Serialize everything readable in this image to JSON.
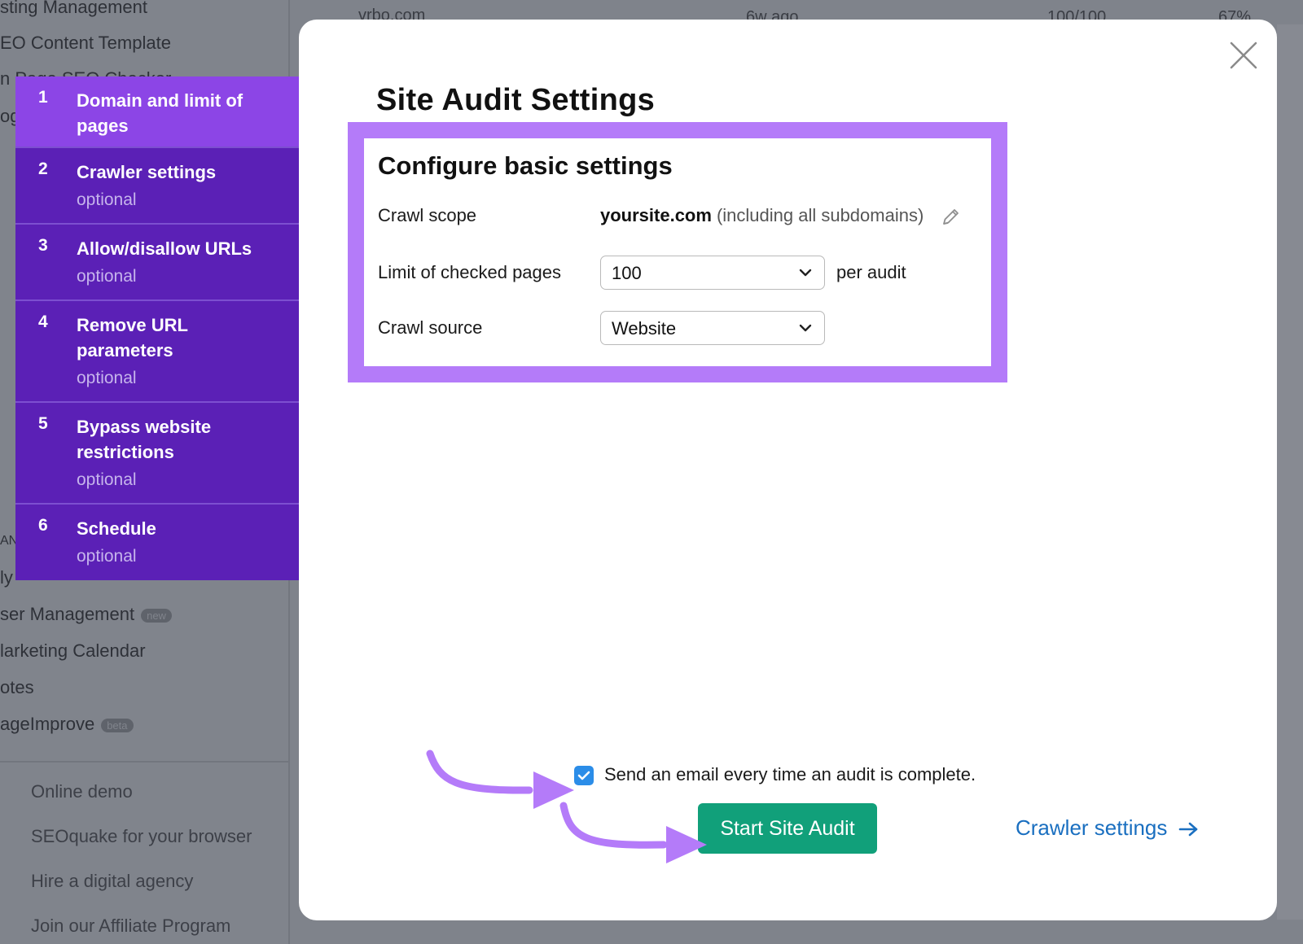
{
  "background": {
    "sidebar_items": [
      {
        "label": "sting Management"
      },
      {
        "label": "EO Content Template"
      },
      {
        "label": "n Page SEO Checker"
      },
      {
        "label": "og"
      }
    ],
    "sidebar_items_lower": [
      {
        "label": "AN"
      },
      {
        "label": "ly"
      },
      {
        "label": "ser Management",
        "badge": "new"
      },
      {
        "label": "larketing Calendar"
      },
      {
        "label": "otes"
      },
      {
        "label": "ageImprove",
        "badge": "beta"
      }
    ],
    "sidebar_footer": [
      {
        "label": "Online demo"
      },
      {
        "label": "SEOquake for your browser"
      },
      {
        "label": "Hire a digital agency"
      },
      {
        "label": "Join our Affiliate Program"
      }
    ],
    "table_row": {
      "domain": "vrbo.com",
      "time": "6w ago",
      "score": "100/100",
      "percent": "67%"
    }
  },
  "steps": [
    {
      "num": "1",
      "title": "Domain and limit of pages",
      "sub": ""
    },
    {
      "num": "2",
      "title": "Crawler settings",
      "sub": "optional"
    },
    {
      "num": "3",
      "title": "Allow/disallow URLs",
      "sub": "optional"
    },
    {
      "num": "4",
      "title": "Remove URL parameters",
      "sub": "optional"
    },
    {
      "num": "5",
      "title": "Bypass website restrictions",
      "sub": "optional"
    },
    {
      "num": "6",
      "title": "Schedule",
      "sub": "optional"
    }
  ],
  "modal": {
    "title": "Site Audit Settings",
    "section_title": "Configure basic settings",
    "crawl_scope": {
      "label": "Crawl scope",
      "domain": "yoursite.com",
      "note": "(including all subdomains)"
    },
    "limit": {
      "label": "Limit of checked pages",
      "value": "100",
      "suffix": "per audit"
    },
    "source": {
      "label": "Crawl source",
      "value": "Website"
    },
    "email_checkbox": {
      "label": "Send an email every time an audit is complete.",
      "checked": true
    },
    "start_button": "Start Site Audit",
    "crawler_link": "Crawler settings"
  },
  "colors": {
    "step_active": "#8c45e6",
    "step_inactive": "#5b20b6",
    "highlight": "#b47bf9",
    "start_button": "#11a07a",
    "link": "#1a6fc0",
    "checkbox": "#2b8de8"
  }
}
